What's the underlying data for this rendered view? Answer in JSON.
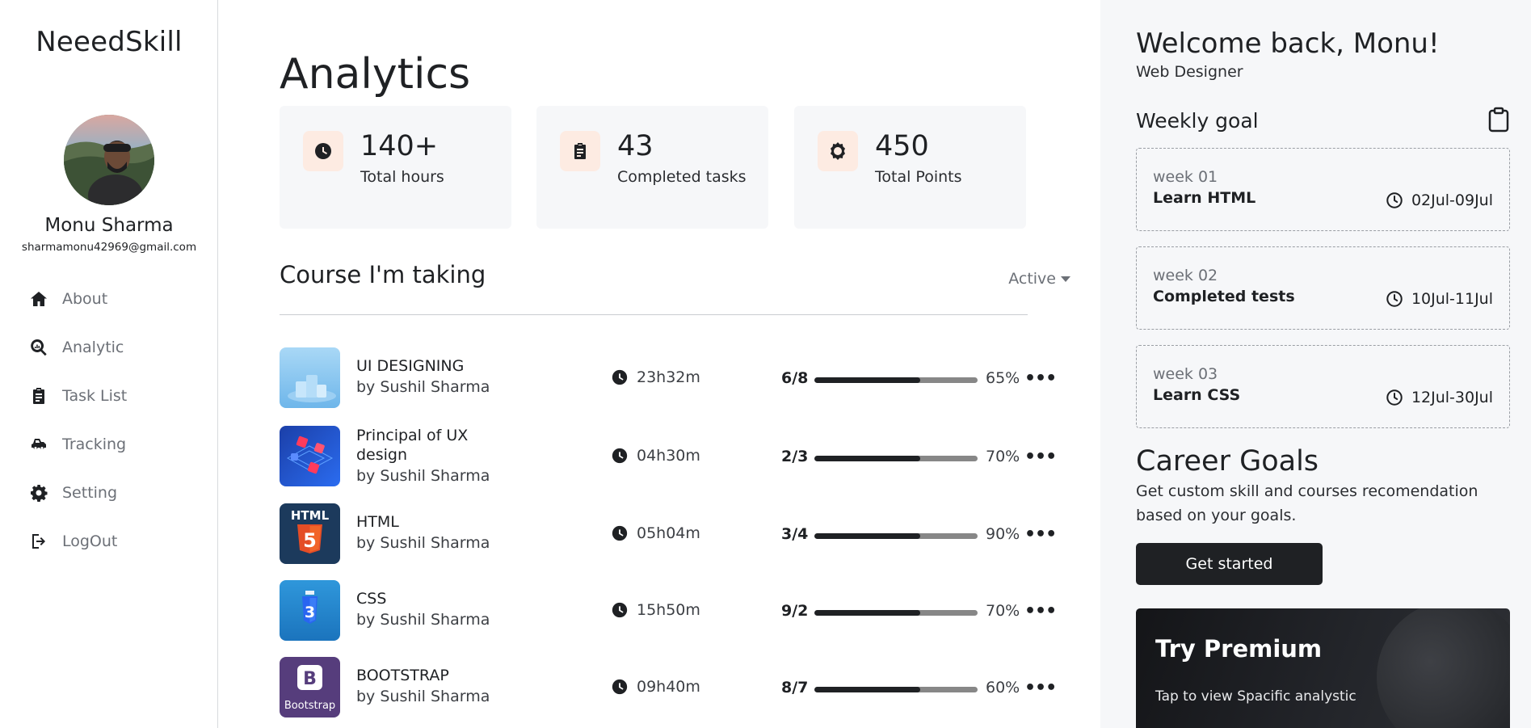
{
  "brand": "NeeedSkill",
  "user": {
    "name": "Monu Sharma",
    "email": "sharmamonu42969@gmail.com"
  },
  "nav": [
    {
      "label": "About",
      "icon": "home-icon"
    },
    {
      "label": "Analytic",
      "icon": "analytic-icon"
    },
    {
      "label": "Task List",
      "icon": "clipboard-icon"
    },
    {
      "label": "Tracking",
      "icon": "truck-icon"
    },
    {
      "label": "Setting",
      "icon": "gear-icon"
    },
    {
      "label": "LogOut",
      "icon": "logout-icon"
    }
  ],
  "main": {
    "title": "Analytics",
    "stats": [
      {
        "value": "140+",
        "label": "Total hours",
        "icon": "clock-icon"
      },
      {
        "value": "43",
        "label": "Completed tasks",
        "icon": "clipboard-icon"
      },
      {
        "value": "450",
        "label": "Total Points",
        "icon": "badge-icon"
      }
    ],
    "courses_title": "Course I'm taking",
    "filter": "Active",
    "courses": [
      {
        "name": "UI DESIGNING",
        "author": "by Sushil Sharma",
        "time": "23h32m",
        "count": "6/8",
        "progress": 0.65,
        "percent": "65%",
        "thumb": "ui-designing-thumbnail"
      },
      {
        "name": "Principal of UX design",
        "author": "by Sushil Sharma",
        "time": "04h30m",
        "count": "2/3",
        "progress": 0.65,
        "percent": "70%",
        "thumb": "ux-design-thumbnail"
      },
      {
        "name": "HTML",
        "author": "by Sushil Sharma",
        "time": "05h04m",
        "count": "3/4",
        "progress": 0.65,
        "percent": "90%",
        "thumb": "html5-logo"
      },
      {
        "name": "CSS",
        "author": "by Sushil Sharma",
        "time": "15h50m",
        "count": "9/2",
        "progress": 0.65,
        "percent": "70%",
        "thumb": "css3-logo"
      },
      {
        "name": "BOOTSTRAP",
        "author": "by Sushil Sharma",
        "time": "09h40m",
        "count": "8/7",
        "progress": 0.65,
        "percent": "60%",
        "thumb": "bootstrap-logo"
      }
    ]
  },
  "thumb_text": {
    "html": "HTML",
    "html_num": "5",
    "css_num": "3",
    "bs_letter": "B",
    "bs_word": "Bootstrap"
  },
  "right": {
    "welcome": "Welcome back, Monu!",
    "role": "Web Designer",
    "weekly_goal": "Weekly goal",
    "weeks": [
      {
        "week": "week 01",
        "title": "Learn HTML",
        "date": "02Jul-09Jul"
      },
      {
        "week": "week 02",
        "title": "Completed tests",
        "date": "10Jul-11Jul"
      },
      {
        "week": "week 03",
        "title": "Learn CSS",
        "date": "12Jul-30Jul"
      }
    ],
    "career_title": "Career Goals",
    "career_desc": "Get custom skill and courses recomendation based on your goals.",
    "cta": "Get started",
    "premium_title": "Try Premium",
    "premium_sub": "Tap to view Spacific analystic"
  }
}
